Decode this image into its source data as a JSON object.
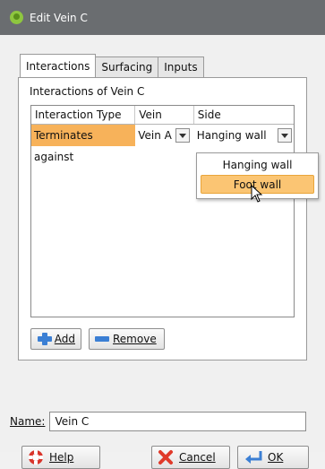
{
  "window": {
    "title": "Edit Vein C"
  },
  "tabs": [
    {
      "label": "Interactions",
      "active": true
    },
    {
      "label": "Surfacing",
      "active": false
    },
    {
      "label": "Inputs",
      "active": false
    }
  ],
  "interactions": {
    "group_label": "Interactions of Vein C",
    "columns": [
      "Interaction Type",
      "Vein",
      "Side"
    ],
    "rows": [
      {
        "type": "Terminates against",
        "vein": "Vein A",
        "side": "Hanging wall"
      }
    ],
    "side_options": [
      "Hanging wall",
      "Foot wall"
    ],
    "highlighted_option": "Foot wall"
  },
  "buttons": {
    "add": "Add",
    "remove": "Remove",
    "help": "Help",
    "cancel": "Cancel",
    "ok": "OK"
  },
  "name_field": {
    "label": "Name:",
    "value": "Vein C"
  },
  "colors": {
    "selected_cell": "#f7b25a",
    "highlight": "#fbc573",
    "titlebar": "#6a6d70"
  }
}
